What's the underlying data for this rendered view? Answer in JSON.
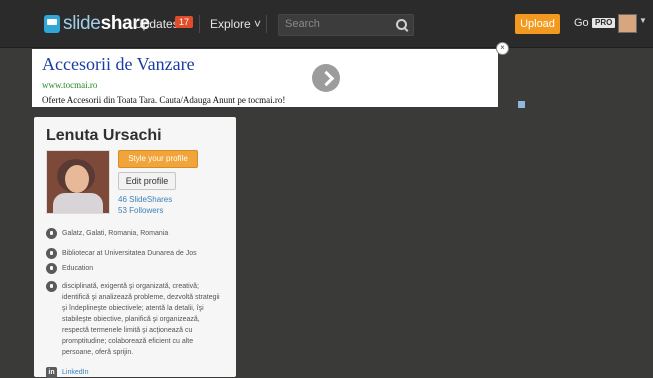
{
  "header": {
    "logo_light": "slide",
    "logo_bold": "share",
    "updates_label": "Updates",
    "updates_count": "17",
    "explore_label": "Explore ˅",
    "search_placeholder": "Search",
    "upload_label": "Upload",
    "go_label": "Go",
    "pro_label": "PRO"
  },
  "ad": {
    "title": "Accesorii de Vanzare",
    "url": "www.tocmai.ro",
    "description": "Oferte Accesorii din Toata Tara. Cauta/Adauga Anunt pe tocmai.ro!"
  },
  "profile": {
    "name": "Lenuta Ursachi",
    "style_button": "Style your profile",
    "edit_button": "Edit profile",
    "slideshares": "46 SlideShares",
    "followers": "53 Followers",
    "location": "Galatz, Galati, Romania, Romania",
    "job": "Bibliotecar at Universitatea Dunarea de Jos",
    "industry": "Education",
    "about": "disciplinată, exigentă şi organizată, creativă; identifică şi analizează probleme, dezvoltă strategii şi îndeplineşte obiectivele; atentă la detalii, îşi stabileşte obiective, planifică şi organizează, respectă termenele limită şi acţionează cu promptitudine; colaborează eficient cu alte persoane, oferă sprijin.",
    "linkedin": "LinkedIn"
  }
}
